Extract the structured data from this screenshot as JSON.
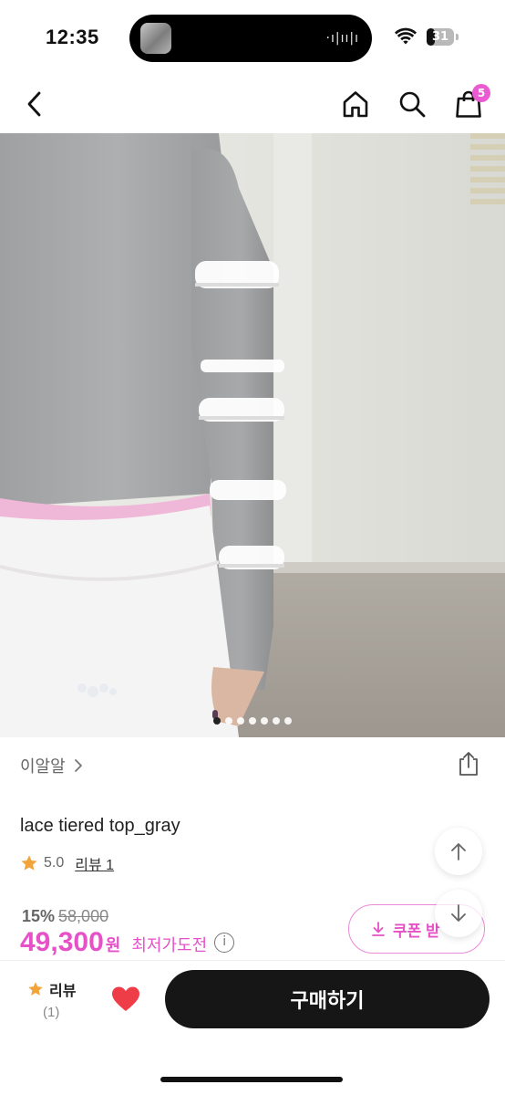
{
  "status_bar": {
    "time": "12:35",
    "battery_level": "31",
    "island_wave": "·ı|ıı|ı"
  },
  "nav": {
    "cart_count": "5"
  },
  "hero": {
    "image_count": 7,
    "current_index": 0
  },
  "product": {
    "brand": "이알알",
    "title": "lace tiered top_gray",
    "rating": "5.0",
    "review_link": "리뷰 1",
    "discount": "15%",
    "original_price": "58,000",
    "price": "49,300",
    "currency": "원",
    "lowest_price_label": "최저가도전",
    "info_icon": "i"
  },
  "coupon": {
    "label": "쿠폰 받"
  },
  "bottom_bar": {
    "review_label": "리뷰",
    "review_count": "(1)",
    "buy_label": "구매하기"
  },
  "colors": {
    "accent": "#e651c8",
    "star": "#f2a33a",
    "heart": "#ef3d48",
    "buy": "#161616"
  }
}
